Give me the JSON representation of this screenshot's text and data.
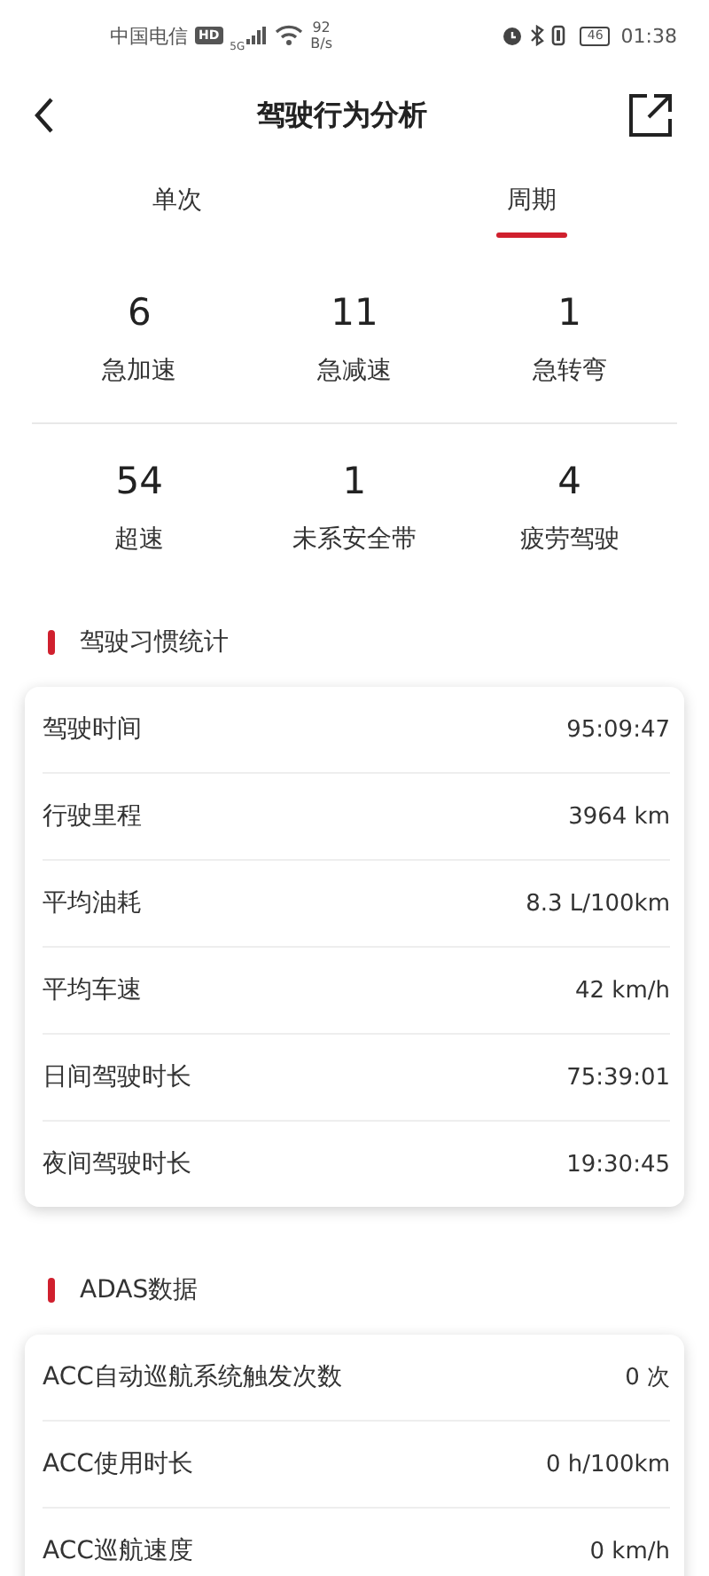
{
  "status_bar": {
    "carrier": "中国电信",
    "hd": "HD",
    "network": "5G",
    "speed_value": "92",
    "speed_unit": "B/s",
    "battery": "46",
    "time": "01:38"
  },
  "header": {
    "title": "驾驶行为分析"
  },
  "tabs": [
    {
      "label": "单次",
      "selected": false
    },
    {
      "label": "周期",
      "selected": true
    }
  ],
  "stats": [
    {
      "value": "6",
      "label": "急加速"
    },
    {
      "value": "11",
      "label": "急减速"
    },
    {
      "value": "1",
      "label": "急转弯"
    },
    {
      "value": "54",
      "label": "超速"
    },
    {
      "value": "1",
      "label": "未系安全带"
    },
    {
      "value": "4",
      "label": "疲劳驾驶"
    }
  ],
  "sections": [
    {
      "title": "驾驶习惯统计",
      "rows": [
        {
          "label": "驾驶时间",
          "value": "95:09:47"
        },
        {
          "label": "行驶里程",
          "value": "3964 km"
        },
        {
          "label": "平均油耗",
          "value": "8.3 L/100km"
        },
        {
          "label": "平均车速",
          "value": "42 km/h"
        },
        {
          "label": "日间驾驶时长",
          "value": "75:39:01"
        },
        {
          "label": "夜间驾驶时长",
          "value": "19:30:45"
        }
      ]
    },
    {
      "title": "ADAS数据",
      "rows": [
        {
          "label": "ACC自动巡航系统触发次数",
          "value": "0 次"
        },
        {
          "label": "ACC使用时长",
          "value": "0 h/100km"
        },
        {
          "label": "ACC巡航速度",
          "value": "0 km/h"
        }
      ]
    }
  ]
}
